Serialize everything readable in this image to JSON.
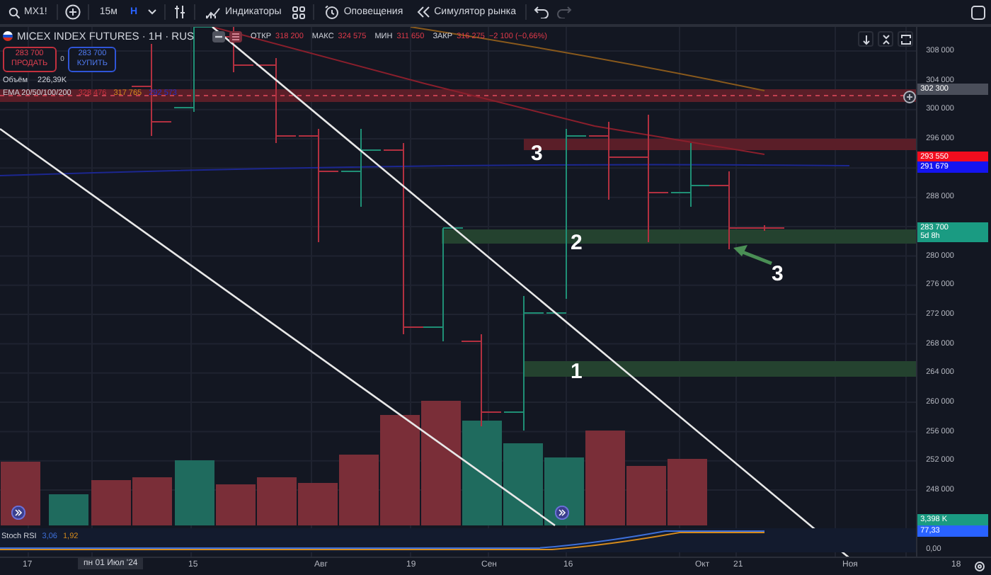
{
  "toolbar": {
    "symbol": "MX1!",
    "interval": "15м",
    "interval_type": "Н",
    "indicators": "Индикаторы",
    "alerts": "Оповещения",
    "replay": "Симулятор рынка"
  },
  "legend": {
    "title": "MICEX INDEX FUTURES · 1H · RUS",
    "ohlc": [
      {
        "label": "ОТКР",
        "value": "318 200"
      },
      {
        "label": "МАКС",
        "value": "324 575"
      },
      {
        "label": "МИН",
        "value": "311 650"
      },
      {
        "label": "ЗАКР",
        "value": "316 275"
      }
    ],
    "change": "−2 100 (−0,66%)",
    "sell": {
      "price": "283 700",
      "label": "ПРОДАТЬ"
    },
    "spread": "0",
    "buy": {
      "price": "283 700",
      "label": "КУПИТЬ"
    },
    "volume": {
      "label": "Объём",
      "value": "226,39K"
    },
    "ema": {
      "label": "EMA 20/50/100/200",
      "values": [
        {
          "text": "328 476",
          "color": "#c2303e"
        },
        {
          "text": "317 765",
          "color": "#d48a1c"
        },
        {
          "text": "292 573",
          "color": "#2430c8"
        }
      ]
    }
  },
  "annotations": [
    {
      "text": "3"
    },
    {
      "text": "2"
    },
    {
      "text": "1"
    },
    {
      "text": "3"
    }
  ],
  "stoch": {
    "label": "Stoch RSI",
    "values": [
      {
        "text": "3,06",
        "color": "#3d6fd8"
      },
      {
        "text": "1,92",
        "color": "#d48a1c"
      }
    ]
  },
  "price_axis": {
    "labels": [
      "308 000",
      "304 000",
      "300 000",
      "296 000",
      "288 000",
      "280 000",
      "276 000",
      "272 000",
      "268 000",
      "264 000",
      "260 000",
      "256 000",
      "252 000",
      "248 000"
    ],
    "badges": [
      {
        "text": "302 300",
        "color": "#4a4e5a"
      },
      {
        "text": "293 550",
        "color": "#f20d1e"
      },
      {
        "text": "291 679",
        "color": "#1414f0"
      },
      {
        "text": "283 700",
        "sub": "5d 8h",
        "color": "#1a9b82"
      },
      {
        "text": "3,398 K",
        "color": "#1a9b82"
      },
      {
        "text": "77,33",
        "color": "#2962ff"
      }
    ],
    "stoch_label": "0,00"
  },
  "time_axis": [
    {
      "text": "17",
      "selected": false
    },
    {
      "text": "пн 01 Июл '24",
      "selected": true
    },
    {
      "text": "15",
      "selected": false
    },
    {
      "text": "Авг",
      "selected": false
    },
    {
      "text": "19",
      "selected": false
    },
    {
      "text": "Сен",
      "selected": false
    },
    {
      "text": "16",
      "selected": false
    },
    {
      "text": "Окт",
      "selected": false
    },
    {
      "text": "21",
      "selected": false
    },
    {
      "text": "Ноя",
      "selected": false
    },
    {
      "text": "18",
      "selected": false
    }
  ]
}
